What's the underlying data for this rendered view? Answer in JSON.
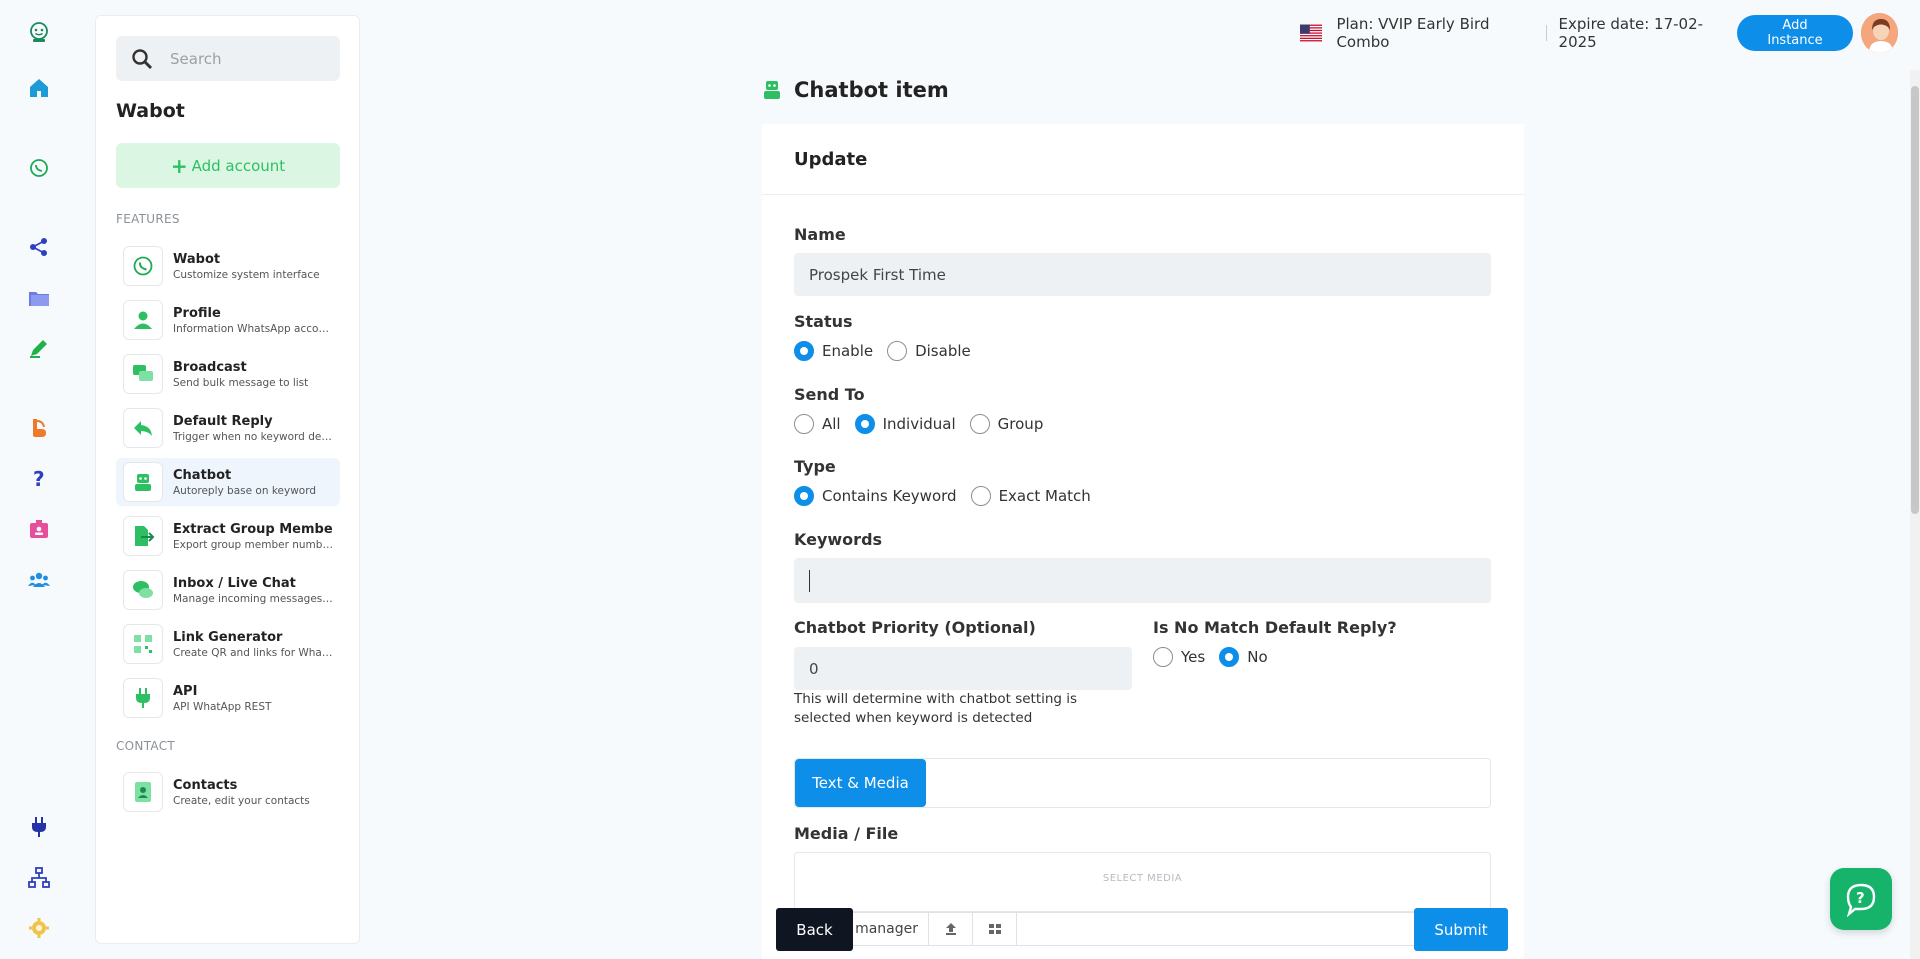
{
  "rail": {
    "icons": [
      "bot-logo-icon",
      "home-icon",
      "whatsapp-icon",
      "share-icon",
      "folder-icon",
      "pen-icon",
      "blogger-icon",
      "help-icon",
      "id-card-icon",
      "users-icon",
      "plug-icon",
      "sitemap-icon",
      "gear-icon"
    ]
  },
  "sidebar": {
    "search_placeholder": "Search",
    "title": "Wabot",
    "add_account": "Add account",
    "features_label": "FEATURES",
    "contact_label": "CONTACT",
    "items": [
      {
        "title": "Wabot",
        "desc": "Customize system interface"
      },
      {
        "title": "Profile",
        "desc": "Information WhatsApp account"
      },
      {
        "title": "Broadcast",
        "desc": "Send bulk message to list"
      },
      {
        "title": "Default Reply",
        "desc": "Trigger when no keyword detected"
      },
      {
        "title": "Chatbot",
        "desc": "Autoreply base on keyword"
      },
      {
        "title": "Extract Group Member",
        "desc": "Export group member number"
      },
      {
        "title": "Inbox / Live Chat",
        "desc": "Manage incoming messages and chats"
      },
      {
        "title": "Link Generator",
        "desc": "Create QR and links for WhatsApp"
      },
      {
        "title": "API",
        "desc": "API WhatApp REST"
      }
    ],
    "contact_items": [
      {
        "title": "Contacts",
        "desc": "Create, edit your contacts"
      }
    ]
  },
  "topbar": {
    "plan": "Plan: VVIP Early Bird Combo",
    "expire": "Expire date: 17-02-2025",
    "add_instance": "Add Instance"
  },
  "page": {
    "title": "Chatbot item",
    "card_title": "Update",
    "name_label": "Name",
    "name_value": "Prospek First Time",
    "status_label": "Status",
    "status_options": [
      "Enable",
      "Disable"
    ],
    "status_selected": "Enable",
    "sendto_label": "Send To",
    "sendto_options": [
      "All",
      "Individual",
      "Group"
    ],
    "sendto_selected": "Individual",
    "type_label": "Type",
    "type_options": [
      "Contains Keyword",
      "Exact Match"
    ],
    "type_selected": "Contains Keyword",
    "keywords_label": "Keywords",
    "keywords_value": "",
    "priority_label": "Chatbot Priority (Optional)",
    "priority_value": "0",
    "priority_help": "This will determine with chatbot setting is selected when keyword is detected",
    "nomatch_label": "Is No Match Default Reply?",
    "nomatch_options": [
      "Yes",
      "No"
    ],
    "nomatch_selected": "No",
    "tab_text_media": "Text & Media",
    "media_label": "Media / File",
    "select_media": "SELECT MEDIA",
    "file_manager": "manager",
    "back": "Back",
    "submit": "Submit"
  },
  "colors": {
    "primary": "#0d8ee9",
    "green": "#2fbf63",
    "dark": "#0f1521"
  }
}
